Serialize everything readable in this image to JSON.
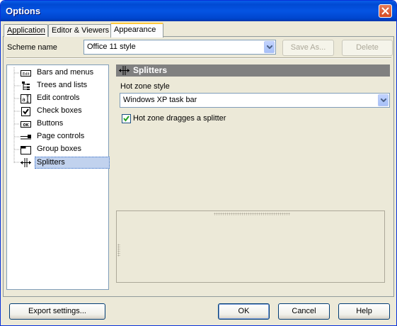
{
  "window": {
    "title": "Options"
  },
  "tabs": [
    {
      "label": "Application"
    },
    {
      "label": "Editor & Viewers"
    },
    {
      "label": "Appearance"
    }
  ],
  "scheme": {
    "label": "Scheme name",
    "value": "Office 11 style",
    "save_as": "Save As...",
    "delete": "Delete"
  },
  "tree": {
    "items": [
      {
        "label": "Bars and menus",
        "icon": "bars-menu-icon"
      },
      {
        "label": "Trees and lists",
        "icon": "tree-list-icon"
      },
      {
        "label": "Edit controls",
        "icon": "edit-control-icon"
      },
      {
        "label": "Check boxes",
        "icon": "checkbox-icon"
      },
      {
        "label": "Buttons",
        "icon": "button-icon"
      },
      {
        "label": "Page controls",
        "icon": "page-control-icon"
      },
      {
        "label": "Group boxes",
        "icon": "group-box-icon"
      },
      {
        "label": "Splitters",
        "icon": "splitter-icon"
      }
    ],
    "selected": "Splitters"
  },
  "panel": {
    "header": "Splitters",
    "hot_zone_label": "Hot zone style",
    "hot_zone_value": "Windows XP task bar",
    "drag_checkbox_label": "Hot zone dragges a splitter",
    "drag_checked": true
  },
  "footer": {
    "export": "Export settings...",
    "ok": "OK",
    "cancel": "Cancel",
    "help": "Help"
  }
}
